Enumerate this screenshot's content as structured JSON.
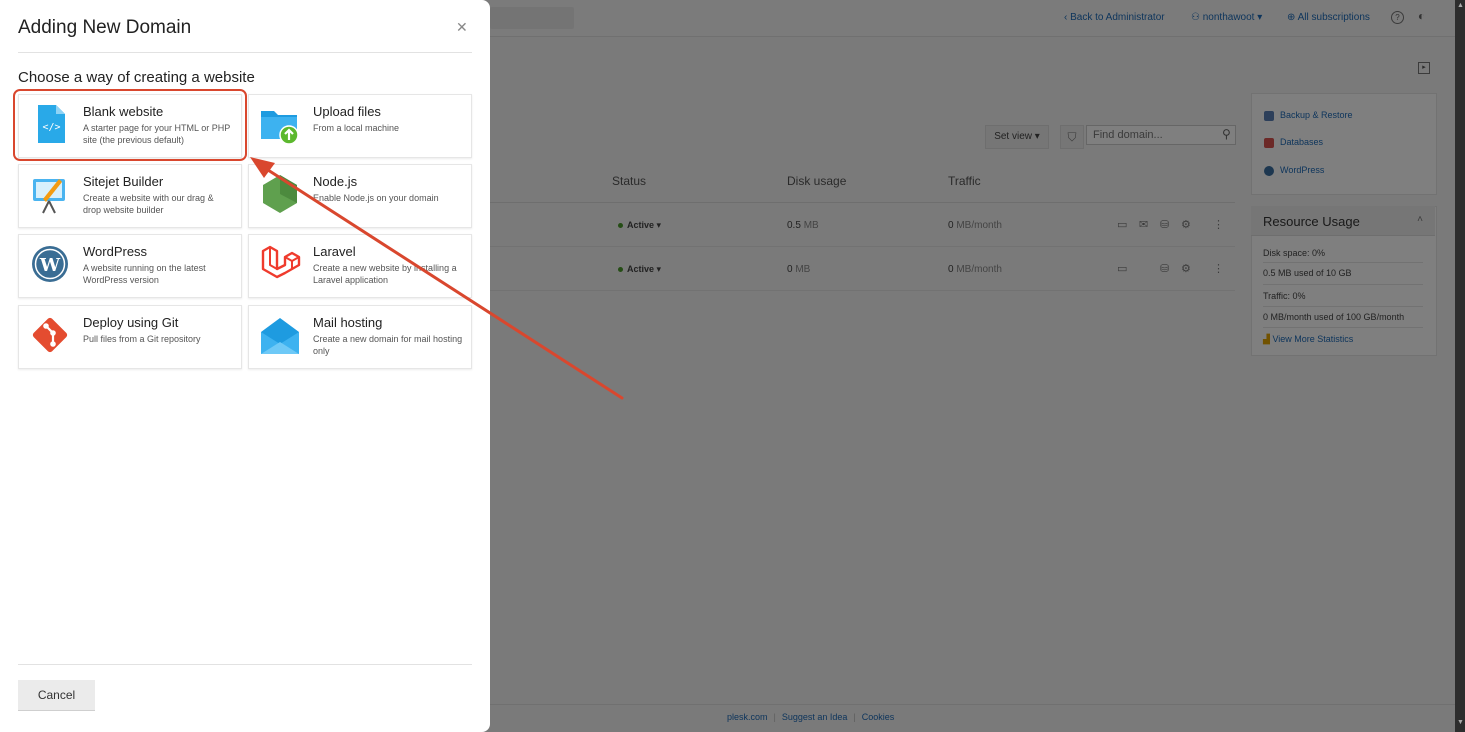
{
  "topbar": {
    "back_label": "Back to Administrator",
    "user_label": "nonthawoot",
    "subscriptions_label": "All subscriptions"
  },
  "domains": {
    "set_view_label": "Set view",
    "search_placeholder": "Find domain...",
    "columns": [
      "Status",
      "Disk usage",
      "Traffic"
    ],
    "rows": [
      {
        "status": "Active",
        "disk_value": "0.5",
        "disk_unit": "MB",
        "traffic_value": "0",
        "traffic_unit": "MB/month"
      },
      {
        "status": "Active",
        "disk_value": "0",
        "disk_unit": "MB",
        "traffic_value": "0",
        "traffic_unit": "MB/month"
      }
    ]
  },
  "sidebar": {
    "links": [
      "Backup & Restore",
      "Databases",
      "WordPress"
    ],
    "resource_usage": {
      "title": "Resource Usage",
      "disk_label": "Disk space: 0%",
      "disk_detail": "0.5 MB used of 10 GB",
      "traffic_label": "Traffic: 0%",
      "traffic_detail": "0 MB/month used of 100 GB/month",
      "stats_link": "View More Statistics"
    }
  },
  "footer": {
    "links": [
      "plesk.com",
      "Suggest an Idea",
      "Cookies"
    ]
  },
  "modal": {
    "title": "Adding New Domain",
    "subtitle": "Choose a way of creating a website",
    "options": [
      {
        "title": "Blank website",
        "desc": "A starter page for your HTML or PHP site (the previous default)",
        "icon": "code-file-icon"
      },
      {
        "title": "Upload files",
        "desc": "From a local machine",
        "icon": "folder-upload-icon"
      },
      {
        "title": "Sitejet Builder",
        "desc": "Create a website with our drag & drop website builder",
        "icon": "sitejet-easel-icon"
      },
      {
        "title": "Node.js",
        "desc": "Enable Node.js on your domain",
        "icon": "nodejs-hexagon-icon"
      },
      {
        "title": "WordPress",
        "desc": "A website running on the latest WordPress version",
        "icon": "wordpress-icon"
      },
      {
        "title": "Laravel",
        "desc": "Create a new website by installing a Laravel application",
        "icon": "laravel-icon"
      },
      {
        "title": "Deploy using Git",
        "desc": "Pull files from a Git repository",
        "icon": "git-icon"
      },
      {
        "title": "Mail hosting",
        "desc": "Create a new domain for mail hosting only",
        "icon": "mail-envelope-icon"
      }
    ],
    "cancel_label": "Cancel"
  },
  "colors": {
    "highlight": "#d9472e",
    "link": "#1d6bb8",
    "active_dot": "#4a9a2a"
  }
}
